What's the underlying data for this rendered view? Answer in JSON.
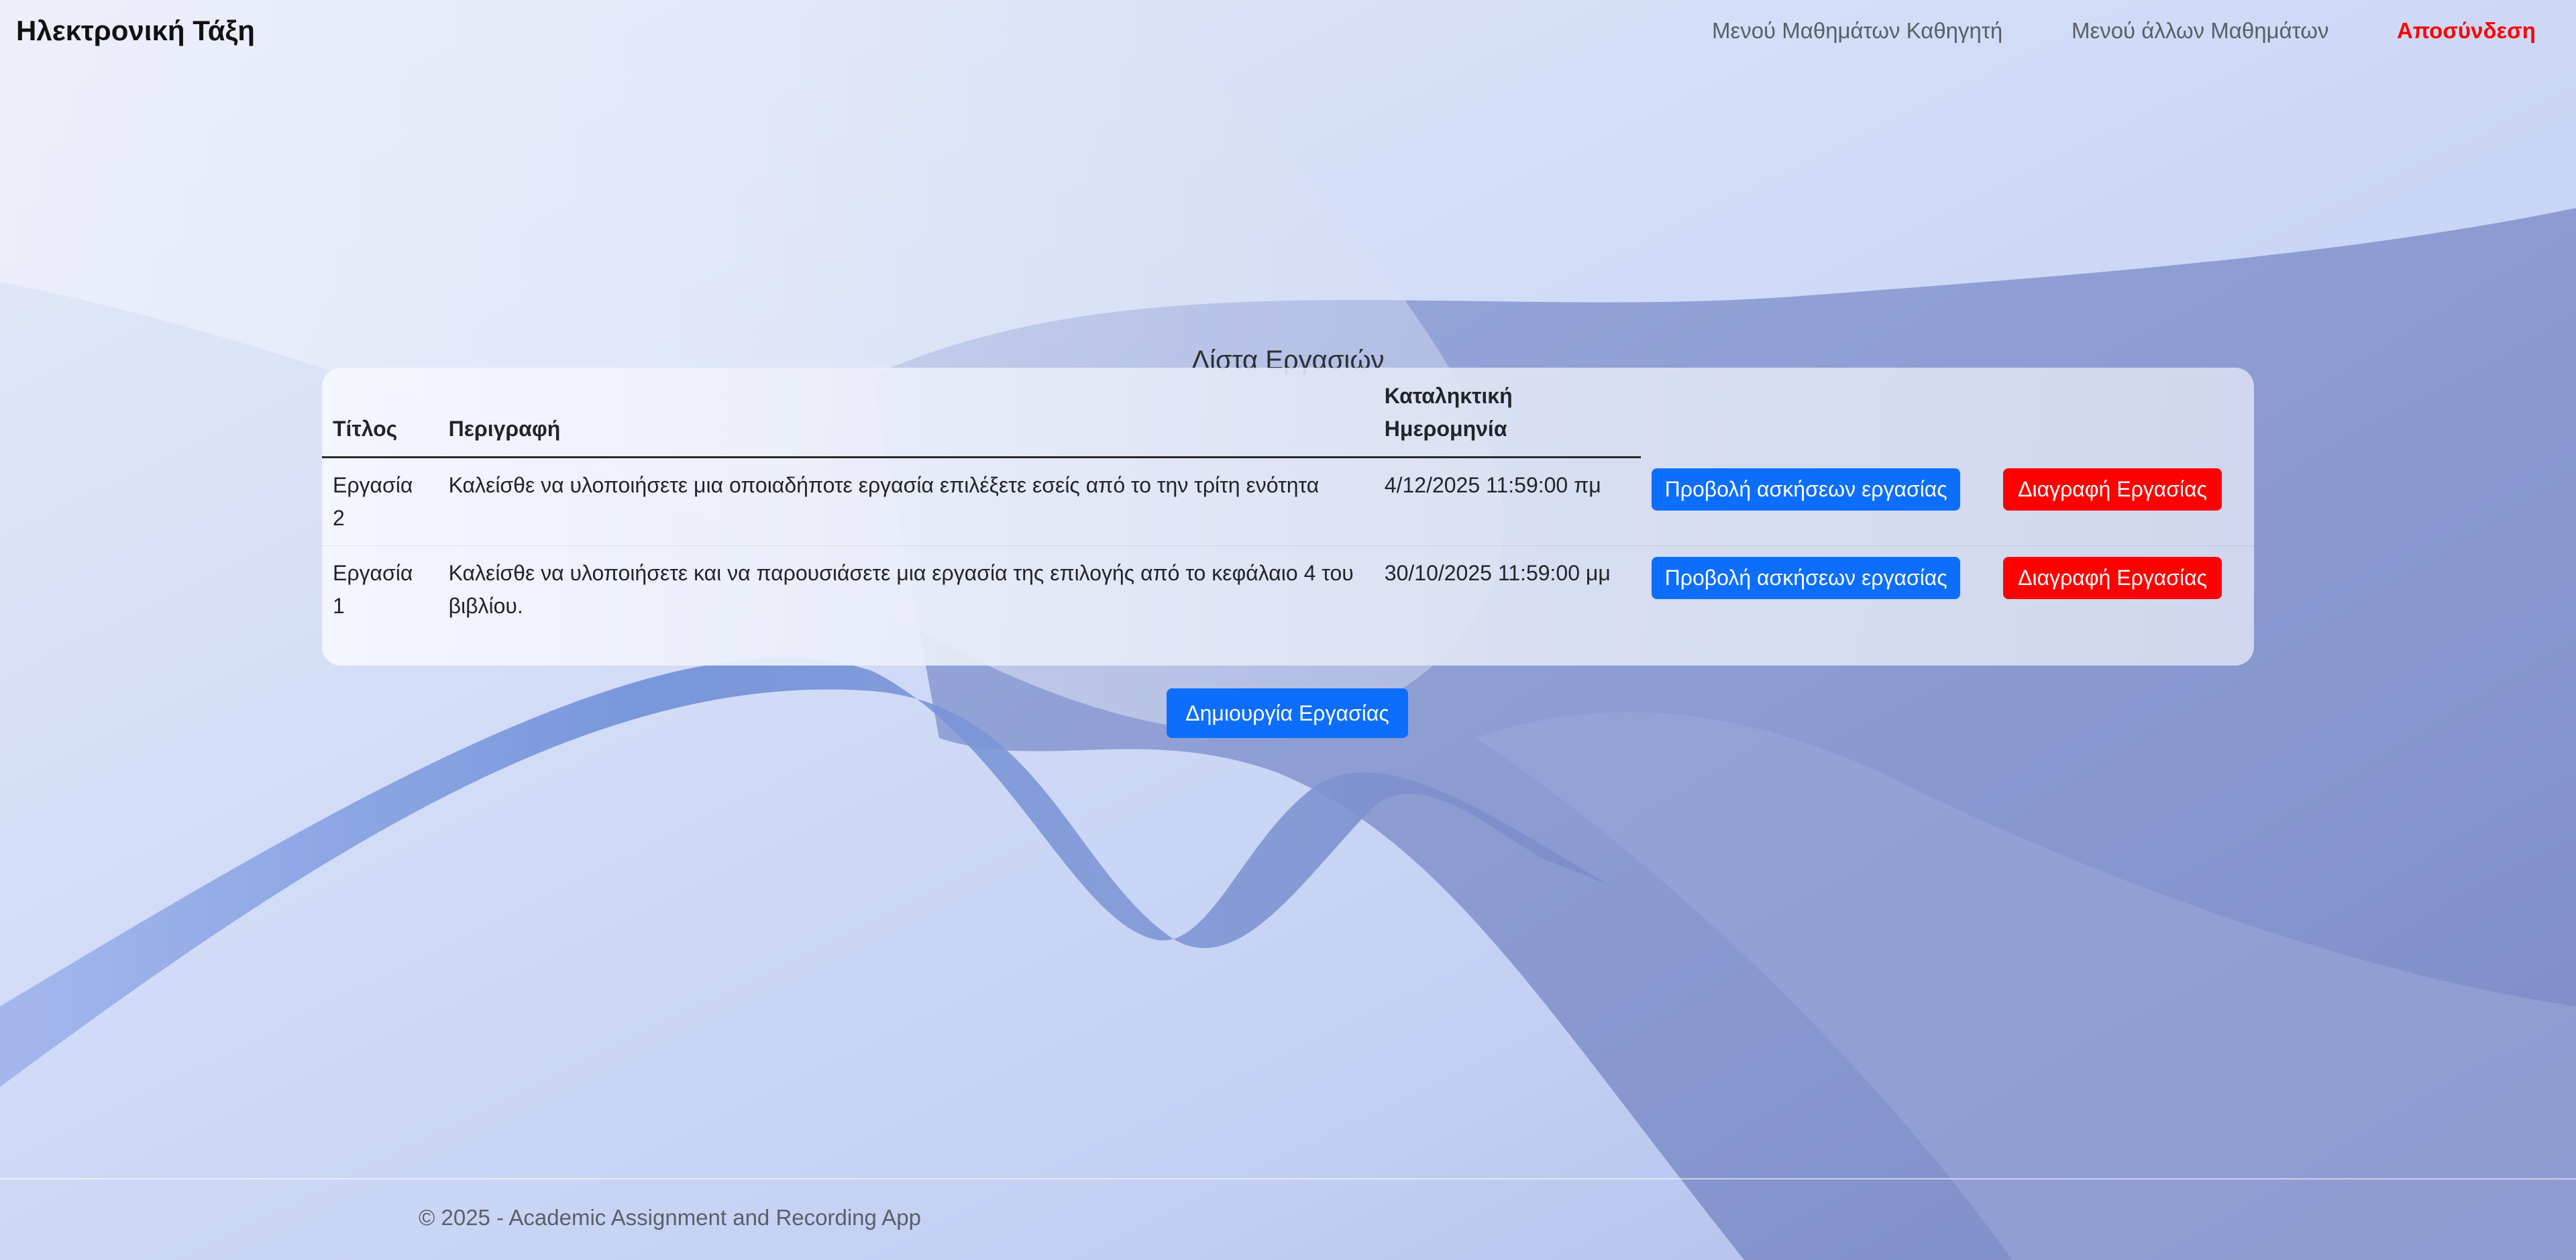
{
  "navbar": {
    "brand": "Ηλεκτρονική Τάξη",
    "links": {
      "teacher_courses": "Μενού Μαθημάτων Καθηγητή",
      "other_courses": "Μενού άλλων Μαθημάτων",
      "logout": "Αποσύνδεση"
    }
  },
  "main": {
    "title": "Λίστα Εργασιών",
    "table": {
      "headers": {
        "title": "Τίτλος",
        "description": "Περιγραφή",
        "deadline": "Καταληκτική Ημερομηνία"
      },
      "rows": [
        {
          "title": "Εργασία 2",
          "description": "Καλείσθε να υλοποιήσετε μια οποιαδήποτε εργασία επιλέξετε εσείς από το την τρίτη ενότητα",
          "deadline": "4/12/2025 11:59:00 πμ",
          "view_label": "Προβολή ασκήσεων εργασίας",
          "delete_label": "Διαγραφή Εργασίας"
        },
        {
          "title": "Εργασία 1",
          "description": "Καλείσθε να υλοποιήσετε και να παρουσιάσετε μια εργασία της επιλογής από το κεφάλαιο 4 του βιβλίου.",
          "deadline": "30/10/2025 11:59:00 μμ",
          "view_label": "Προβολή ασκήσεων εργασίας",
          "delete_label": "Διαγραφή Εργασίας"
        }
      ]
    },
    "create_label": "Δημιουργία Εργασίας"
  },
  "footer": {
    "text": "© 2025 - Academic Assignment and Recording App"
  },
  "colors": {
    "primary": "#0d6efd",
    "danger": "#ff0000",
    "logout": "#ff0000"
  }
}
